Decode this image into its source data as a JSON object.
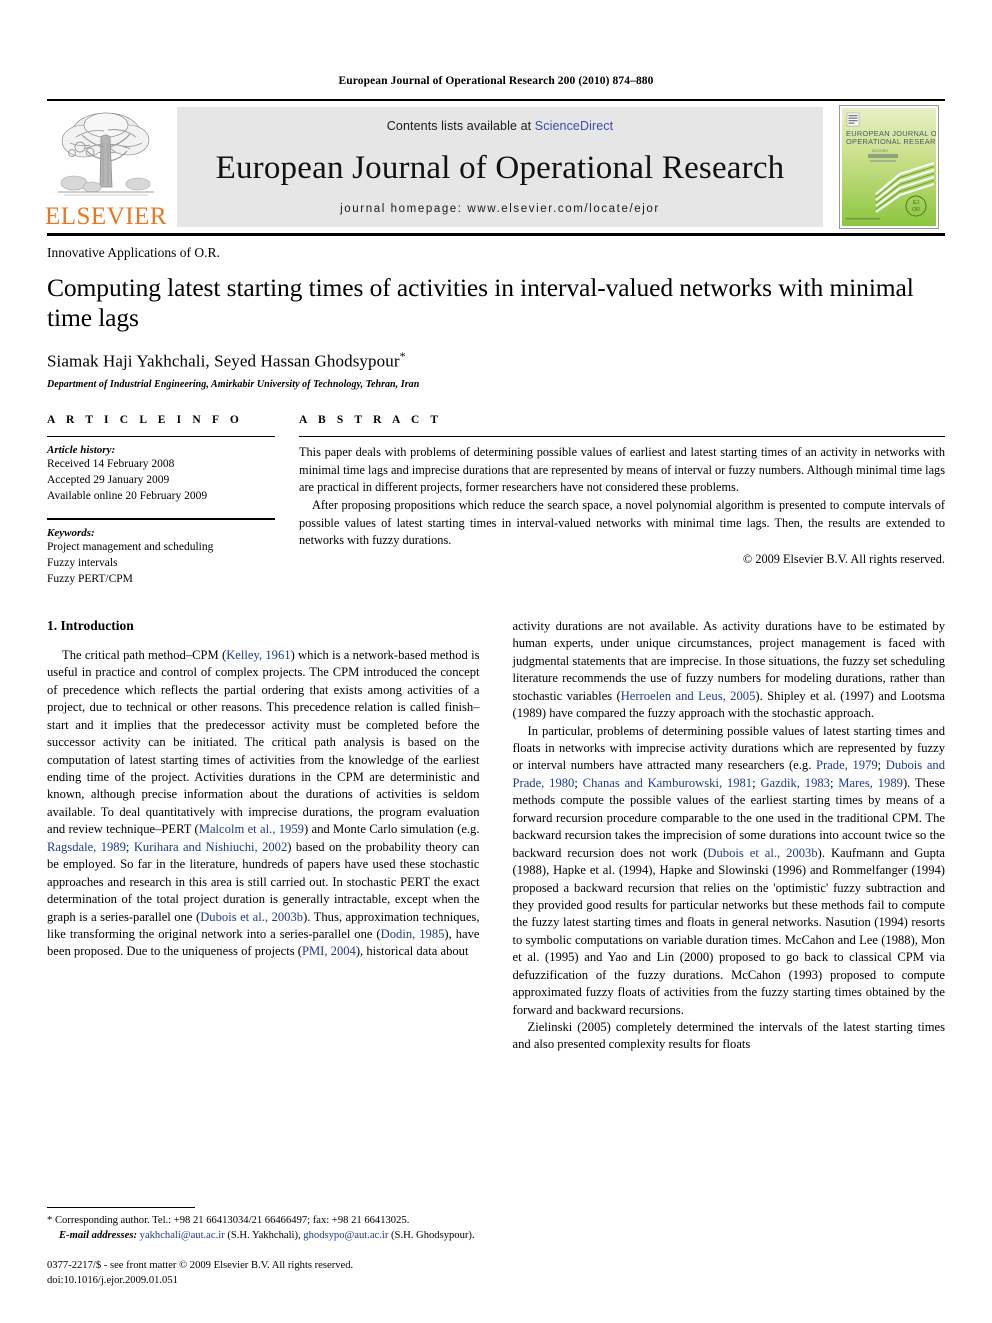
{
  "running_head": "European Journal of Operational Research 200 (2010) 874–880",
  "masthead": {
    "publisher_logo_text": "ELSEVIER",
    "contents_prefix": "Contents lists available at ",
    "sciencedirect": "ScienceDirect",
    "journal_title": "European Journal of Operational Research",
    "homepage": "journal homepage: www.elsevier.com/locate/ejor",
    "cover_line1": "EUROPEAN JOURNAL OF",
    "cover_line2": "OPERATIONAL RESEARCH",
    "cover_badge": "EJOR",
    "colors": {
      "elsevier_orange": "#E87722",
      "link_blue": "#3b4db0",
      "reference_blue": "#1f3a8a",
      "masthead_grey": "#e6e6e6",
      "cover_green": "#8cc63f"
    }
  },
  "article": {
    "kicker": "Innovative Applications of O.R.",
    "title": "Computing latest starting times of activities in interval-valued networks with minimal time lags",
    "authors": "Siamak Haji Yakhchali, Seyed Hassan Ghodsypour",
    "corresponding_marker": "*",
    "affiliation": "Department of Industrial Engineering, Amirkabir University of Technology, Tehran, Iran"
  },
  "article_info": {
    "heading": "A R T I C L E    I N F O",
    "history_label": "Article history:",
    "history": [
      "Received 14 February 2008",
      "Accepted 29 January 2009",
      "Available online 20 February 2009"
    ],
    "keywords_label": "Keywords:",
    "keywords": [
      "Project management and scheduling",
      "Fuzzy intervals",
      "Fuzzy PERT/CPM"
    ]
  },
  "abstract": {
    "heading": "A B S T R A C T",
    "paragraph_1": "This paper deals with problems of determining possible values of earliest and latest starting times of an activity in networks with minimal time lags and imprecise durations that are represented by means of interval or fuzzy numbers. Although minimal time lags are practical in different projects, former researchers have not considered these problems.",
    "paragraph_2": "After proposing propositions which reduce the search space, a novel polynomial algorithm is presented to compute intervals of possible values of latest starting times in interval-valued networks with minimal time lags. Then, the results are extended to networks with fuzzy durations.",
    "copyright": "© 2009 Elsevier B.V. All rights reserved."
  },
  "introduction": {
    "heading": "1. Introduction",
    "left_paragraph": "The critical path method–CPM (Kelley, 1961) which is a network-based method is useful in practice and control of complex projects. The CPM introduced the concept of precedence which reflects the partial ordering that exists among activities of a project, due to technical or other reasons. This precedence relation is called finish–start and it implies that the predecessor activity must be completed before the successor activity can be initiated. The critical path analysis is based on the computation of latest starting times of activities from the knowledge of the earliest ending time of the project. Activities durations in the CPM are deterministic and known, although precise information about the durations of activities is seldom available. To deal quantitatively with imprecise durations, the program evaluation and review technique–PERT (Malcolm et al., 1959) and Monte Carlo simulation (e.g. Ragsdale, 1989; Kurihara and Nishiuchi, 2002) based on the probability theory can be employed. So far in the literature, hundreds of papers have used these stochastic approaches and research in this area is still carried out. In stochastic PERT the exact determination of the total project duration is generally intractable, except when the graph is a series-parallel one (Dubois et al., 2003b). Thus, approximation techniques, like transforming the original network into a series-parallel one (Dodin, 1985), have been proposed. Due to the uniqueness of projects (PMI, 2004), historical data about",
    "right_paragraph_1": "activity durations are not available. As activity durations have to be estimated by human experts, under unique circumstances, project management is faced with judgmental statements that are imprecise. In those situations, the fuzzy set scheduling literature recommends the use of fuzzy numbers for modeling durations, rather than stochastic variables (Herroelen and Leus, 2005). Shipley et al. (1997) and Lootsma (1989) have compared the fuzzy approach with the stochastic approach.",
    "right_paragraph_2": "In particular, problems of determining possible values of latest starting times and floats in networks with imprecise activity durations which are represented by fuzzy or interval numbers have attracted many researchers (e.g. Prade, 1979; Dubois and Prade, 1980; Chanas and Kamburowski, 1981; Gazdik, 1983; Mares, 1989). These methods compute the possible values of the earliest starting times by means of a forward recursion procedure comparable to the one used in the traditional CPM. The backward recursion takes the imprecision of some durations into account twice so the backward recursion does not work (Dubois et al., 2003b). Kaufmann and Gupta (1988), Hapke et al. (1994), Hapke and Slowinski (1996) and Rommelfanger (1994) proposed a backward recursion that relies on the 'optimistic' fuzzy subtraction and they provided good results for particular networks but these methods fail to compute the fuzzy latest starting times and floats in general networks. Nasution (1994) resorts to symbolic computations on variable duration times. McCahon and Lee (1988), Mon et al. (1995) and Yao and Lin (2000) proposed to go back to classical CPM via defuzzification of the fuzzy durations. McCahon (1993) proposed to compute approximated fuzzy floats of activities from the fuzzy starting times obtained by the forward and backward recursions.",
    "right_paragraph_3": "Zielinski (2005) completely determined the intervals of the latest starting times and also presented complexity results for floats"
  },
  "footnotes": {
    "corresponding": "* Corresponding author. Tel.: +98 21 66413034/21 66466497; fax: +98 21 66413025.",
    "email_label": "E-mail addresses:",
    "email_1": "yakhchali@aut.ac.ir",
    "email_1_owner": "(S.H. Yakhchali),",
    "email_2": "ghodsypo@aut.ac.ir",
    "email_2_owner": "(S.H. Ghodsypour).",
    "issn_line": "0377-2217/$ - see front matter © 2009 Elsevier B.V. All rights reserved.",
    "doi_line": "doi:10.1016/j.ejor.2009.01.051"
  }
}
